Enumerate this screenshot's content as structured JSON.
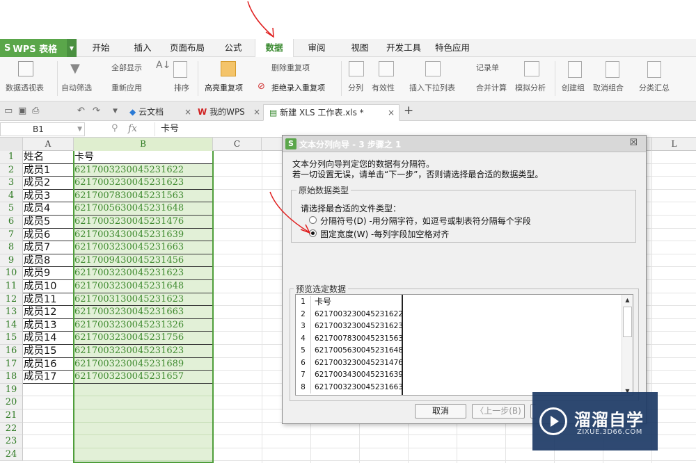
{
  "menubar": {
    "app_name": "WPS 表格",
    "tabs": [
      "开始",
      "插入",
      "页面布局",
      "公式",
      "数据",
      "审阅",
      "视图",
      "开发工具",
      "特色应用"
    ],
    "active_tab": "数据"
  },
  "ribbon": {
    "pivot": "数据透视表",
    "autofilter": "自动筛选",
    "show_all": "全部显示",
    "reapply": "重新应用",
    "sort": "排序",
    "highlight_dup": "高亮重复项",
    "delete_dup": "删除重复项",
    "reject_dup": "拒绝录入重复项",
    "split": "分列",
    "validity": "有效性",
    "insert_dropdown": "插入下拉列表",
    "record_form": "记录单",
    "consolidate": "合并计算",
    "simulate": "模拟分析",
    "create_group": "创建组",
    "ungroup": "取消组合",
    "subtotal": "分类汇总"
  },
  "doctabs": {
    "cloud": "云文档",
    "mywps": "我的WPS",
    "active_file": "新建 XLS 工作表.xls *"
  },
  "formula_bar": {
    "cell_ref": "B1",
    "fx": "fx",
    "value": "卡号"
  },
  "grid": {
    "columns": [
      "A",
      "B",
      "C",
      "L"
    ],
    "row_numbers": [
      "1",
      "2",
      "3",
      "4",
      "5",
      "6",
      "7",
      "8",
      "9",
      "10",
      "11",
      "12",
      "13",
      "14",
      "15",
      "16",
      "17",
      "18",
      "19",
      "20",
      "21",
      "22",
      "23",
      "24"
    ],
    "rows": [
      [
        "姓名",
        "卡号"
      ],
      [
        "成员1",
        "6217003230045231622"
      ],
      [
        "成员2",
        "6217003230045231623"
      ],
      [
        "成员3",
        "6217007830045231563"
      ],
      [
        "成员4",
        "6217005630045231648"
      ],
      [
        "成员5",
        "6217003230045231476"
      ],
      [
        "成员6",
        "6217003430045231639"
      ],
      [
        "成员7",
        "6217003230045231663"
      ],
      [
        "成员8",
        "6217009430045231456"
      ],
      [
        "成员9",
        "6217003230045231623"
      ],
      [
        "成员10",
        "6217003230045231648"
      ],
      [
        "成员11",
        "6217003130045231623"
      ],
      [
        "成员12",
        "6217003230045231663"
      ],
      [
        "成员13",
        "6217003230045231326"
      ],
      [
        "成员14",
        "6217003230045231756"
      ],
      [
        "成员15",
        "6217003230045231623"
      ],
      [
        "成员16",
        "6217003230045231689"
      ],
      [
        "成员17",
        "6217003230045231657"
      ]
    ]
  },
  "dialog": {
    "title": "文本分列向导 - 3 步骤之 1",
    "close": "☒",
    "intro1": "文本分列向导判定您的数据有分隔符。",
    "intro2": "若一切设置无误，请单击“下一步”，否则请选择最合适的数据类型。",
    "group1_label": "原始数据类型",
    "prompt": "请选择最合适的文件类型：",
    "option1": "分隔符号(D)  -用分隔字符，如逗号或制表符分隔每个字段",
    "option2": "固定宽度(W)  -每列字段加空格对齐",
    "selected_option": "固定宽度(W)",
    "preview_label": "预览选定数据",
    "preview_rows": [
      [
        "1",
        "卡号"
      ],
      [
        "2",
        "6217003230045231622"
      ],
      [
        "3",
        "6217003230045231623"
      ],
      [
        "4",
        "6217007830045231563"
      ],
      [
        "5",
        "6217005630045231648"
      ],
      [
        "6",
        "6217003230045231476"
      ],
      [
        "7",
        "6217003430045231639"
      ],
      [
        "8",
        "6217003230045231663"
      ]
    ],
    "cancel": "取消",
    "back": "〈上一步(B)"
  },
  "watermark": {
    "name": "溜溜自学",
    "url": "ZIXUE.3D66.COM"
  },
  "colors": {
    "wps_green": "#5aa64a",
    "selection_fill": "#e2f0d7",
    "annotation_red": "#e02020",
    "watermark_bg": "#1d3a66"
  }
}
